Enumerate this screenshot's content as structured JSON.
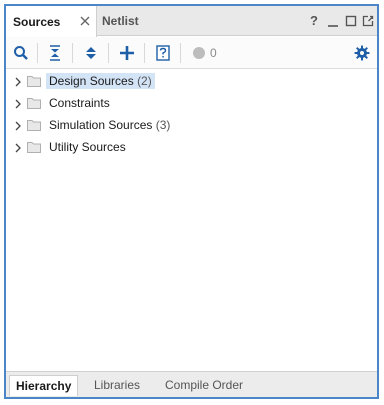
{
  "tabs": {
    "sources_label": "Sources",
    "netlist_label": "Netlist"
  },
  "window_controls": {
    "help_label": "?"
  },
  "toolbar": {
    "status_count": "0"
  },
  "tree": {
    "items": [
      {
        "label": "Design Sources",
        "count": "(2)",
        "selected": true
      },
      {
        "label": "Constraints",
        "count": "",
        "selected": false
      },
      {
        "label": "Simulation Sources",
        "count": "(3)",
        "selected": false
      },
      {
        "label": "Utility Sources",
        "count": "",
        "selected": false
      }
    ]
  },
  "bottom_tabs": {
    "hierarchy_label": "Hierarchy",
    "libraries_label": "Libraries",
    "compile_order_label": "Compile Order"
  },
  "colors": {
    "border": "#4a86c8",
    "accent": "#1f5fa8",
    "selection": "#d4e4f7"
  },
  "icons": [
    "search-icon",
    "collapse-all-icon",
    "expand-all-icon",
    "add-icon",
    "properties-icon",
    "status-dot-icon",
    "gear-icon",
    "folder-icon",
    "chevron-right-icon",
    "close-icon",
    "help-icon",
    "minimize-icon",
    "maximize-icon",
    "float-icon"
  ]
}
